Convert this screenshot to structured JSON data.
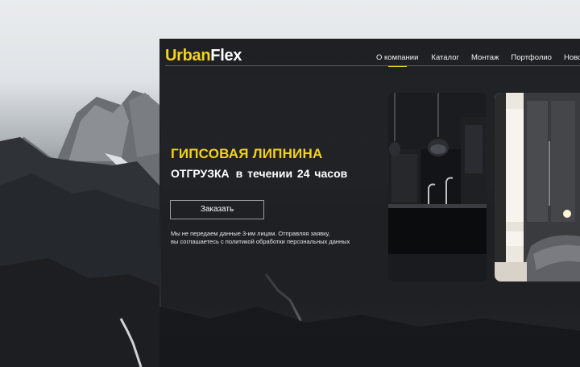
{
  "brand": {
    "part1": "Urban",
    "part2": "Flex"
  },
  "nav": {
    "items": [
      "О компании",
      "Каталог",
      "Монтаж",
      "Портфолио",
      "Новости"
    ],
    "active_index": 0
  },
  "hero": {
    "title": "ГИПСОВАЯ ЛИПНИНА",
    "subtitle_a": "ОТГРУЗКА",
    "subtitle_b": "в течении 24 часов",
    "button_label": "Заказать",
    "note_line1": "Мы не передаем данные 3-им лицам. Отправляя заявку,",
    "note_line2": "вы соглашаетесь с политикой обработки персональных данных"
  },
  "colors": {
    "accent": "#f4d21c",
    "panel": "#1a1b1f",
    "text": "#ffffff"
  },
  "icons": {
    "card1": "kitchen-photo",
    "card2": "bedroom-photo",
    "background": "mountain-photo"
  }
}
